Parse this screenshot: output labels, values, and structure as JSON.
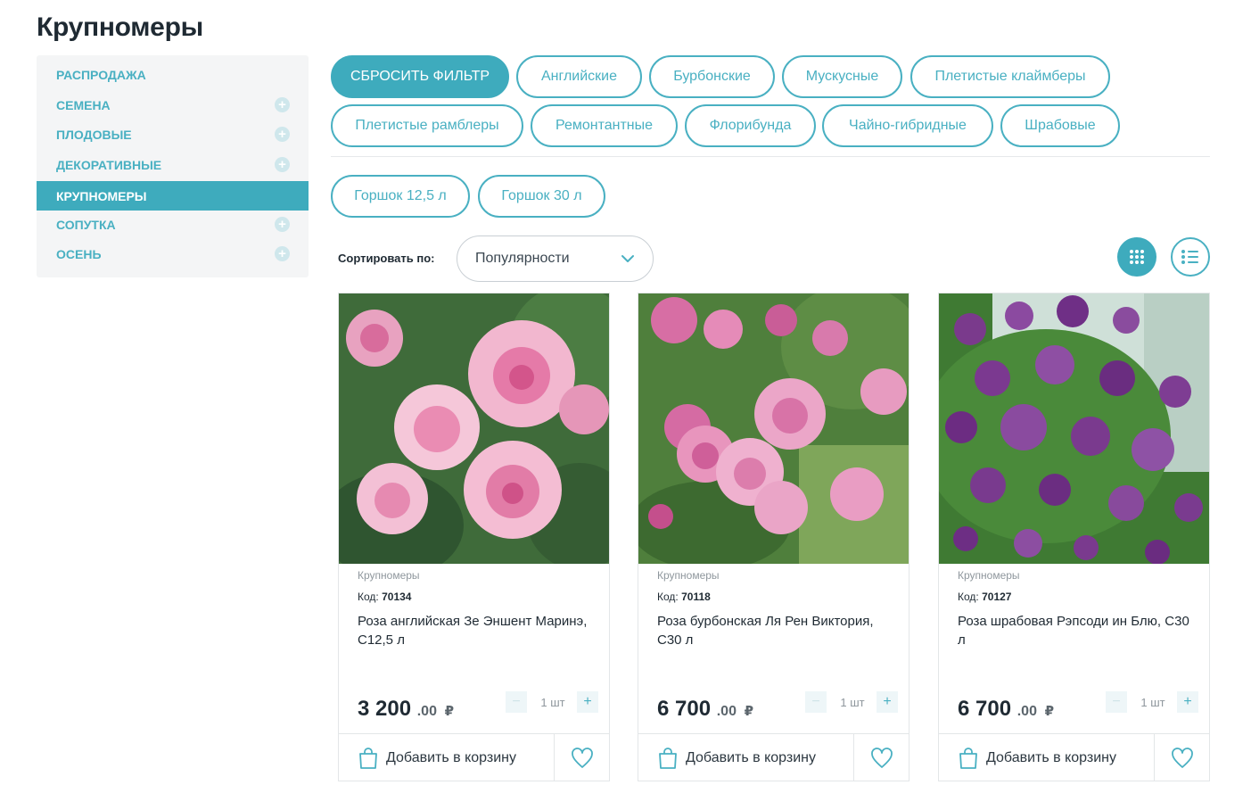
{
  "page": {
    "title": "Крупномеры"
  },
  "sidebar": {
    "items": [
      {
        "label": "РАСПРОДАЖА",
        "expandable": false,
        "active": false
      },
      {
        "label": "СЕМЕНА",
        "expandable": true,
        "active": false
      },
      {
        "label": "ПЛОДОВЫЕ",
        "expandable": true,
        "active": false
      },
      {
        "label": "ДЕКОРАТИВНЫЕ",
        "expandable": true,
        "active": false
      },
      {
        "label": "КРУПНОМЕРЫ",
        "expandable": false,
        "active": true
      },
      {
        "label": "СОПУТКА",
        "expandable": true,
        "active": false
      },
      {
        "label": "ОСЕНЬ",
        "expandable": true,
        "active": false
      }
    ],
    "plus_symbol": "+"
  },
  "filters": {
    "reset_label": "СБРОСИТЬ ФИЛЬТР",
    "types": [
      "Английские",
      "Бурбонские",
      "Мускусные",
      "Плетистые клаймберы",
      "Плетистые рамблеры",
      "Ремонтантные",
      "Флорибунда",
      "Чайно-гибридные",
      "Шрабовые"
    ],
    "pots": [
      "Горшок 12,5 л",
      "Горшок 30 л"
    ]
  },
  "sort": {
    "label": "Сортировать по:",
    "selected": "Популярности"
  },
  "view": {
    "grid_icon": "grid-icon",
    "list_icon": "list-icon",
    "active": "grid"
  },
  "colors": {
    "accent": "#3eabbd",
    "text": "#1f2a33",
    "muted": "#8f979d"
  },
  "products": [
    {
      "category": "Крупномеры",
      "code_label": "Код:",
      "code": "70134",
      "name": "Роза английская Зе Эншент Маринэ, С12,5 л",
      "price_int": "3 200",
      "price_cents": ".00",
      "currency": "₽",
      "qty": "1 шт",
      "minus": "−",
      "plus": "+",
      "cart_label": "Добавить в корзину",
      "image": "pink-roses-photo"
    },
    {
      "category": "Крупномеры",
      "code_label": "Код:",
      "code": "70118",
      "name": "Роза бурбонская Ля Рен Виктория, С30 л",
      "price_int": "6 700",
      "price_cents": ".00",
      "currency": "₽",
      "qty": "1 шт",
      "minus": "−",
      "plus": "+",
      "cart_label": "Добавить в корзину",
      "image": "pink-bourbon-roses-photo"
    },
    {
      "category": "Крупномеры",
      "code_label": "Код:",
      "code": "70127",
      "name": "Роза шрабовая Рэпсоди ин Блю, С30 л",
      "price_int": "6 700",
      "price_cents": ".00",
      "currency": "₽",
      "qty": "1 шт",
      "minus": "−",
      "plus": "+",
      "cart_label": "Добавить в корзину",
      "image": "purple-roses-photo"
    }
  ]
}
